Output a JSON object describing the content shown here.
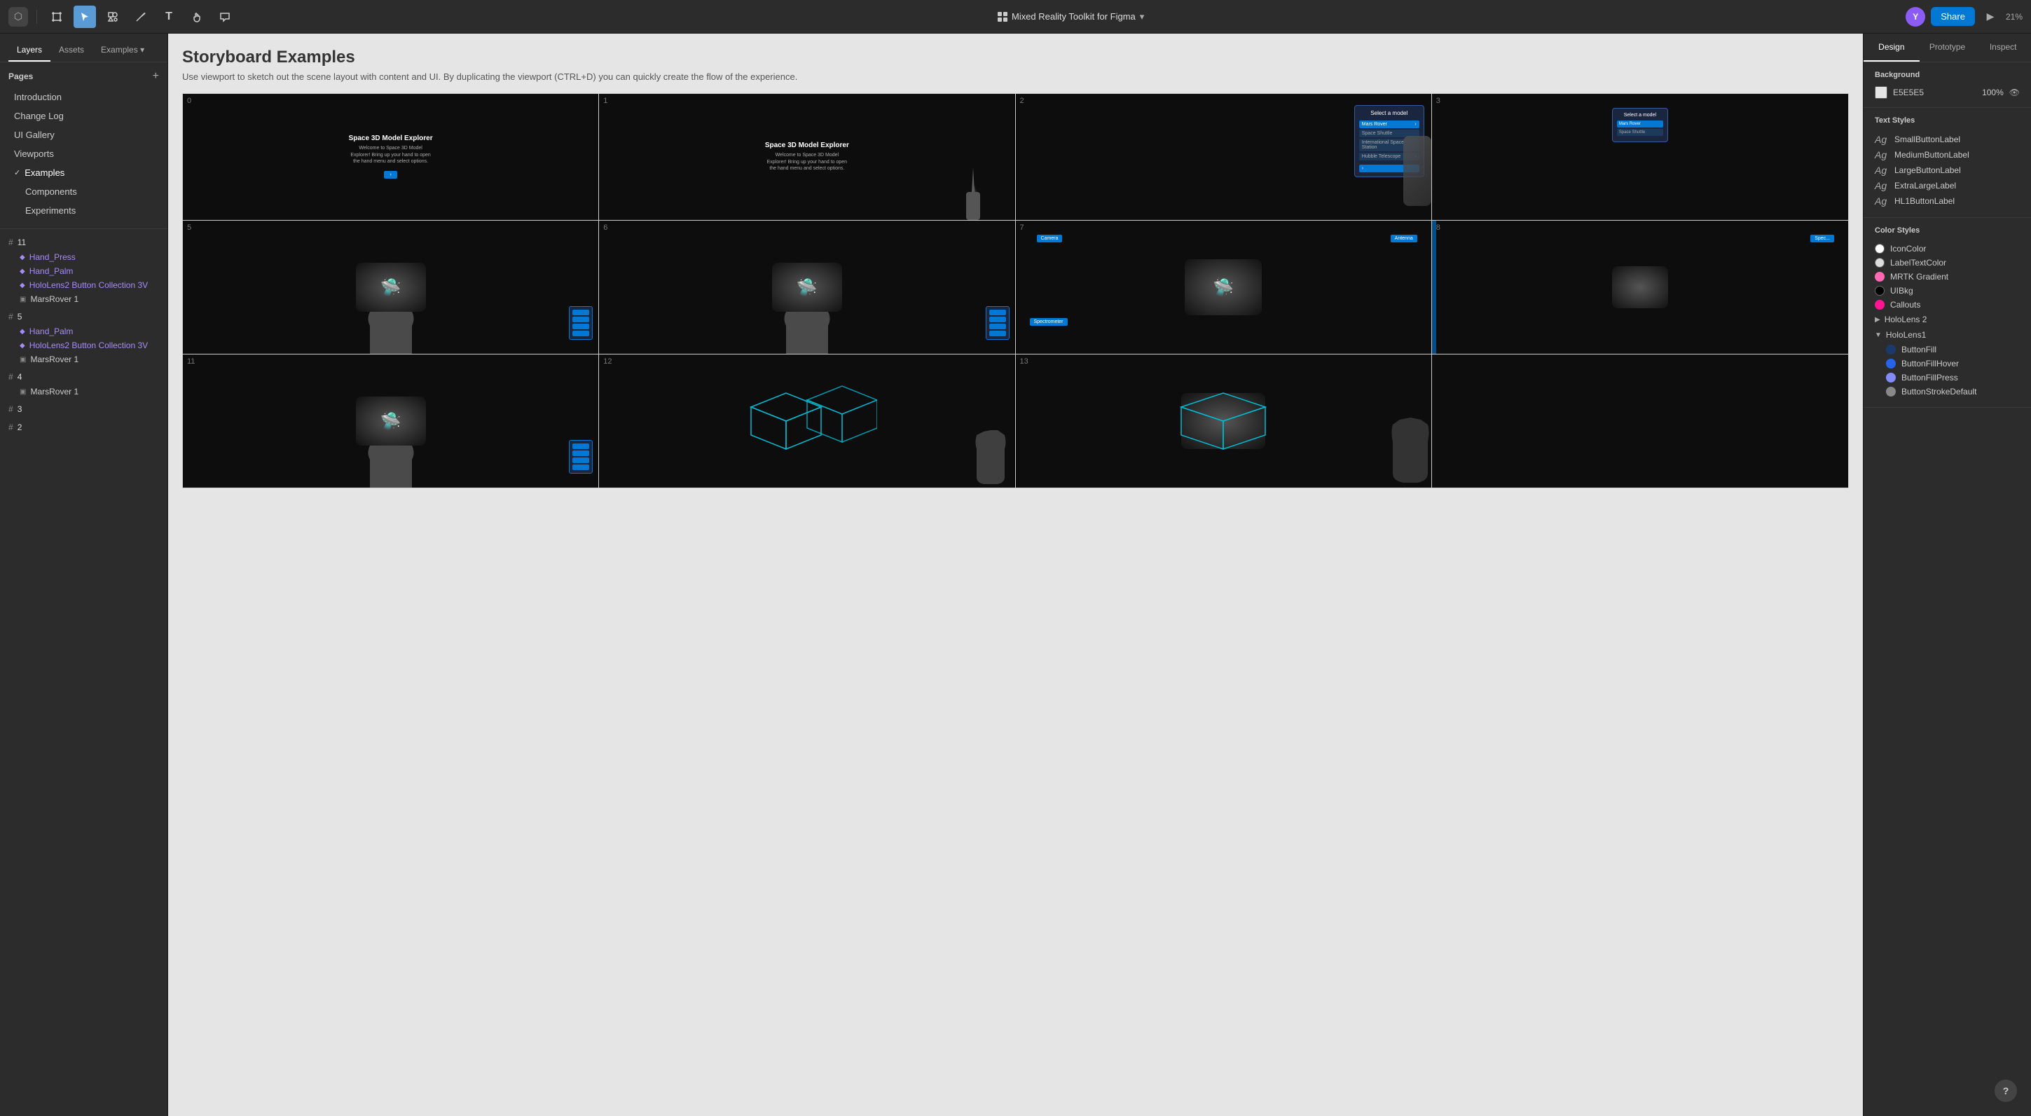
{
  "toolbar": {
    "title": "Mixed Reality Toolkit for Figma",
    "zoom": "21%",
    "share_label": "Share",
    "avatar_initial": "Y"
  },
  "left_panel": {
    "tabs": [
      "Layers",
      "Assets",
      "Examples"
    ],
    "active_tab": "Layers",
    "pages_label": "Pages",
    "pages": [
      {
        "label": "Introduction",
        "active": false
      },
      {
        "label": "Change Log",
        "active": false
      },
      {
        "label": "UI Gallery",
        "active": false
      },
      {
        "label": "Viewports",
        "active": false
      },
      {
        "label": "Examples",
        "active": true,
        "group": true
      },
      {
        "label": "Components",
        "active": false,
        "sub": true
      },
      {
        "label": "Experiments",
        "active": false,
        "sub": true
      }
    ],
    "layers": [
      {
        "id": "11",
        "items": [
          {
            "name": "Hand_Press",
            "type": "component"
          },
          {
            "name": "Hand_Palm",
            "type": "component"
          },
          {
            "name": "HoloLens2 Button Collection 3V",
            "type": "component"
          },
          {
            "name": "MarsRover 1",
            "type": "image"
          }
        ]
      },
      {
        "id": "5",
        "items": [
          {
            "name": "Hand_Palm",
            "type": "component"
          },
          {
            "name": "HoloLens2 Button Collection 3V",
            "type": "component"
          },
          {
            "name": "MarsRover 1",
            "type": "image"
          }
        ]
      },
      {
        "id": "4",
        "items": [
          {
            "name": "MarsRover 1",
            "type": "image"
          }
        ]
      },
      {
        "id": "3",
        "items": []
      },
      {
        "id": "2",
        "items": []
      }
    ]
  },
  "canvas": {
    "title": "Storyboard Examples",
    "subtitle": "Use viewport to sketch out the scene layout with content and UI. By duplicating the viewport (CTRL+D) you can quickly create the flow of the experience.",
    "cells": [
      {
        "num": "0",
        "type": "text_scene",
        "title": "Space 3D Model Explorer",
        "body": "Welcome to Space 3D Model Explorer! Bring up your hand to open the hand menu and select options."
      },
      {
        "num": "1",
        "type": "text_scene_hand",
        "title": "Space 3D Model Explorer",
        "body": "Welcome to Space 3D Model Explorer! Bring up your hand to open the hand menu and select options."
      },
      {
        "num": "2",
        "type": "menu_scene",
        "title": "Select a model"
      },
      {
        "num": "3",
        "type": "menu_scene_partial"
      },
      {
        "num": "5",
        "type": "rover_hand"
      },
      {
        "num": "6",
        "type": "rover_hand"
      },
      {
        "num": "7",
        "type": "rover_tags"
      },
      {
        "num": "8",
        "type": "rover_partial"
      },
      {
        "num": "11",
        "type": "rover_hand2"
      },
      {
        "num": "12",
        "type": "wireframe"
      },
      {
        "num": "13",
        "type": "rover_wireframe"
      }
    ]
  },
  "right_panel": {
    "tabs": [
      "Design",
      "Prototype",
      "Inspect"
    ],
    "active_tab": "Design",
    "background": {
      "label": "Background",
      "hex": "E5E5E5",
      "opacity": "100%"
    },
    "text_styles": {
      "label": "Text Styles",
      "items": [
        {
          "label": "SmallButtonLabel"
        },
        {
          "label": "MediumButtonLabel"
        },
        {
          "label": "LargeButtonLabel"
        },
        {
          "label": "ExtraLargeLabel"
        },
        {
          "label": "HL1ButtonLabel"
        }
      ]
    },
    "color_styles": {
      "label": "Color Styles",
      "items": [
        {
          "name": "IconColor",
          "dot": "white"
        },
        {
          "name": "LabelTextColor",
          "dot": "light-gray"
        },
        {
          "name": "MRTK Gradient",
          "dot": "pink"
        },
        {
          "name": "UIBkg",
          "dot": "black"
        },
        {
          "name": "Callouts",
          "dot": "hot-pink"
        }
      ],
      "groups": [
        {
          "name": "HoloLens 2",
          "expanded": false,
          "items": []
        },
        {
          "name": "HoloLens1",
          "expanded": true,
          "items": [
            {
              "name": "ButtonFill",
              "dot": "dark-blue"
            },
            {
              "name": "ButtonFillHover",
              "dot": "medium-blue"
            },
            {
              "name": "ButtonFillPress",
              "dot": "blue-purple"
            },
            {
              "name": "ButtonStrokeDefault",
              "dot": "gray-stroke"
            }
          ]
        }
      ]
    }
  }
}
